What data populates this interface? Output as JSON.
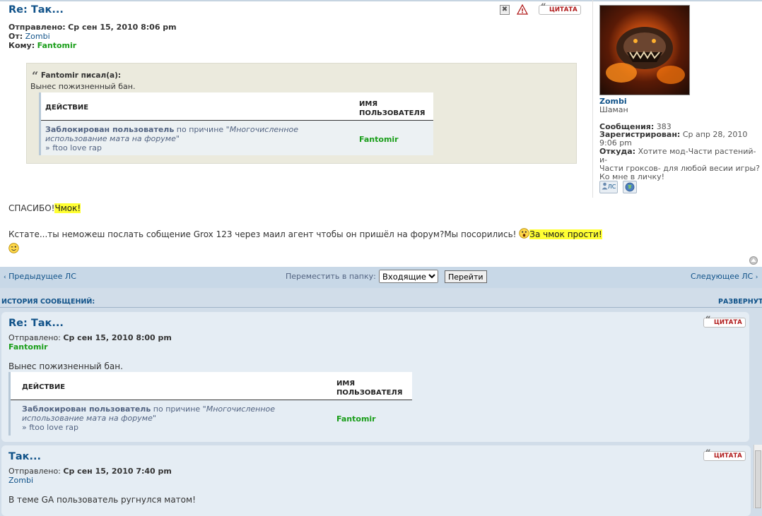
{
  "main_post": {
    "title": "Re: Так...",
    "sent_label": "Отправлено:",
    "sent_value": "Ср сен 15, 2010 8:06 pm",
    "from_label": "От:",
    "from_value": "Zombi",
    "to_label": "Кому:",
    "to_value": "Fantomir",
    "quote_button": "ЦИТАТА",
    "quote": {
      "author": "Fantomir писал(а):",
      "text": "Вынес пожизненный бан.",
      "table": {
        "col_action": "ДЕЙСТВИЕ",
        "col_user_1": "ИМЯ",
        "col_user_2": "ПОЛЬЗОВАТЕЛЯ",
        "action_bold": "Заблокирован пользователь",
        "action_reason_prefix": " по причине \"",
        "action_reason_1": "Многочисленное",
        "action_reason_2": "использование мата на форуме",
        "action_reason_suffix": "\"",
        "action_sub": "» ftoo love rap",
        "user": "Fantomir"
      }
    },
    "body_line1_text": "СПАСИБО!",
    "body_line1_highlight": "Чмок!",
    "body_line2_text": "Кстате...ты неможеш послать собщение Grox 123 через маил агент чтобы он пришёл на форум?Мы посорились!",
    "body_line2_highlight": "За чмок прости!"
  },
  "profile": {
    "username": "Zombi",
    "rank": "Шаман",
    "posts_label": "Сообщения:",
    "posts_value": "383",
    "registered_label": "Зарегистрирован:",
    "registered_value_1": "Ср апр 28, 2010",
    "registered_value_2": "9:06 pm",
    "from_label": "Откуда:",
    "from_value_1": "Хотите мод-Части растений-и-",
    "from_value_2": "Части гроксов- для любой весии игры?",
    "from_value_3": "Ко мне в личку!",
    "pm_button": "ЛС"
  },
  "nav": {
    "prev": "Предыдущее ЛС",
    "move_label": "Переместить в папку:",
    "folder_selected": "Входящие",
    "go_button": "Перейти",
    "next": "Следующее ЛС"
  },
  "history": {
    "label": "ИСТОРИЯ СООБЩЕНИЙ:",
    "expand": "РАЗВЕРНУТЬ"
  },
  "history_post_1": {
    "title": "Re: Так...",
    "sent_label": "Отправлено:",
    "sent_value": "Ср сен 15, 2010 8:00 pm",
    "author": "Fantomir",
    "quote_button": "ЦИТАТА",
    "text": "Вынес пожизненный бан.",
    "table": {
      "col_action": "ДЕЙСТВИЕ",
      "col_user_1": "ИМЯ",
      "col_user_2": "ПОЛЬЗОВАТЕЛЯ",
      "action_bold": "Заблокирован пользователь",
      "action_reason_prefix": " по причине \"",
      "action_reason_1": "Многочисленное",
      "action_reason_2": "использование мата на форуме",
      "action_reason_suffix": "\"",
      "action_sub": "» ftoo love rap",
      "user": "Fantomir"
    }
  },
  "history_post_2": {
    "title": "Так...",
    "sent_label": "Отправлено:",
    "sent_value": "Ср сен 15, 2010 7:40 pm",
    "author": "Zombi",
    "quote_button": "ЦИТАТА",
    "text": "В теме GA пользователь ругнулся матом!"
  }
}
